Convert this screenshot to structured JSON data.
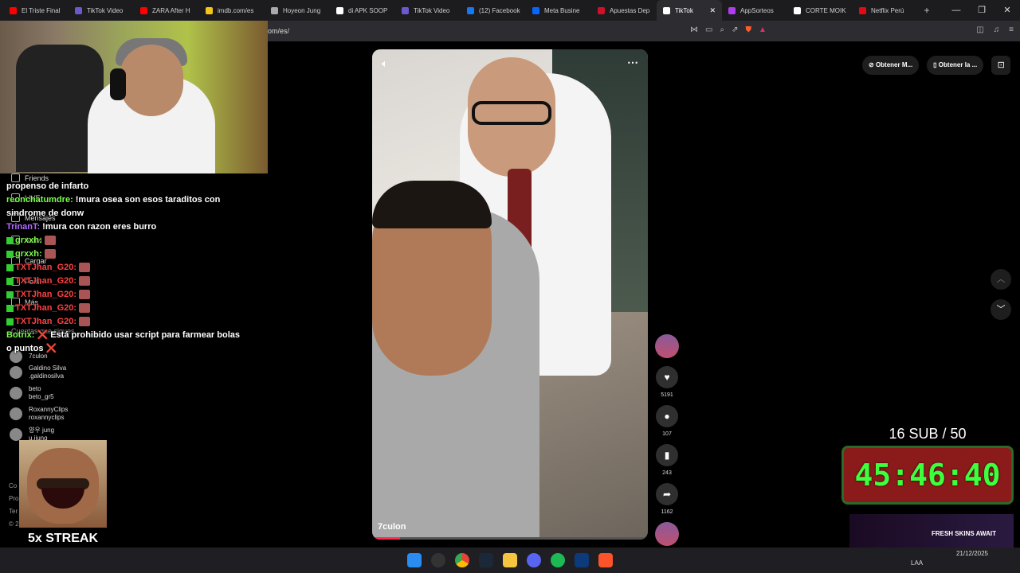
{
  "browser": {
    "tabs": [
      {
        "title": "El Triste Final",
        "color": "#ff0000",
        "active": false
      },
      {
        "title": "TikTok Video",
        "color": "#6a5acd",
        "active": false
      },
      {
        "title": "ZARA After H",
        "color": "#ff0000",
        "active": false
      },
      {
        "title": "imdb.com/es",
        "color": "#f5c518",
        "active": false
      },
      {
        "title": "Hoyeon Jung",
        "color": "#aaaaaa",
        "active": false
      },
      {
        "title": "di APK SOOP",
        "color": "#ffffff",
        "active": false
      },
      {
        "title": "TikTok Video",
        "color": "#6a5acd",
        "active": false
      },
      {
        "title": "(12) Facebook",
        "color": "#1877f2",
        "active": false
      },
      {
        "title": "Meta Busine",
        "color": "#0866ff",
        "active": false
      },
      {
        "title": "Apuestas Dep",
        "color": "#d0102a",
        "active": false
      },
      {
        "title": "TikTok",
        "color": "#ffffff",
        "active": true
      },
      {
        "title": "AppSorteos",
        "color": "#b03cf0",
        "active": false
      },
      {
        "title": "CORTE MOIK",
        "color": "#ffffff",
        "active": false
      },
      {
        "title": "Netflix Perú",
        "color": "#e50914",
        "active": false
      }
    ],
    "url": "om/es/"
  },
  "sidebar": {
    "nav": [
      "Friends",
      "LIVE",
      "Mensajes",
      "Activi",
      "Cargar",
      "Perfil",
      "Más"
    ],
    "following_title": "Cuentas que sigues",
    "following": [
      {
        "name": "7culon",
        "handle": ""
      },
      {
        "name": "Galdino Silva",
        "handle": ".galdinosilva"
      },
      {
        "name": "beto",
        "handle": "beto_gr5"
      },
      {
        "name": "RoxannyClips",
        "handle": "roxannyclips"
      },
      {
        "name": "양우 jung",
        "handle": "u.jiung"
      }
    ],
    "footer": [
      "Co",
      "Pro",
      "Ter",
      "© 2"
    ]
  },
  "chat": [
    {
      "user": "",
      "user_color": "#ffffff",
      "text": "propenso de infarto"
    },
    {
      "user": "reonchatumdre:",
      "user_color": "#7cfc4a",
      "text": "!mura osea son esos taraditos con sindrome de donw"
    },
    {
      "user": "TrinanT:",
      "user_color": "#b06cff",
      "text": "!mura con razon eres burro"
    },
    {
      "user": "grxxh:",
      "user_color": "#7cfc4a",
      "text": "",
      "emote": true
    },
    {
      "user": "grxxh:",
      "user_color": "#7cfc4a",
      "text": "",
      "emote": true
    },
    {
      "user": "TXTJhan_G20:",
      "user_color": "#ff4040",
      "text": "",
      "emote": true
    },
    {
      "user": "TXTJhan_G20:",
      "user_color": "#ff4040",
      "text": "",
      "emote": true
    },
    {
      "user": "TXTJhan_G20:",
      "user_color": "#ff4040",
      "text": "",
      "emote": true
    },
    {
      "user": "TXTJhan_G20:",
      "user_color": "#ff4040",
      "text": "",
      "emote": true
    },
    {
      "user": "TXTJhan_G20:",
      "user_color": "#ff4040",
      "text": "",
      "emote": true
    },
    {
      "user": "Botrix:",
      "user_color": "#7cfc4a",
      "text": "❌ Está prohibido usar script para farmear bolas o puntos ❌"
    }
  ],
  "overlay": {
    "streak": "5x STREAK",
    "sub_goal": "16 SUB / 50",
    "timer": "45:46:40",
    "promo": "FRESH SKINS AWAIT"
  },
  "video": {
    "author": "7culon",
    "mute_icon": "speaker-icon",
    "more": "⋯",
    "progress": 0.1
  },
  "actions": {
    "likes": "5191",
    "comments": "107",
    "saves": "243",
    "shares": "1162"
  },
  "topright": {
    "btn1": "Obtener M...",
    "btn2": "Obtener la ..."
  },
  "taskbar": {
    "language": "LAA",
    "time": "",
    "date": "21/12/2025"
  }
}
